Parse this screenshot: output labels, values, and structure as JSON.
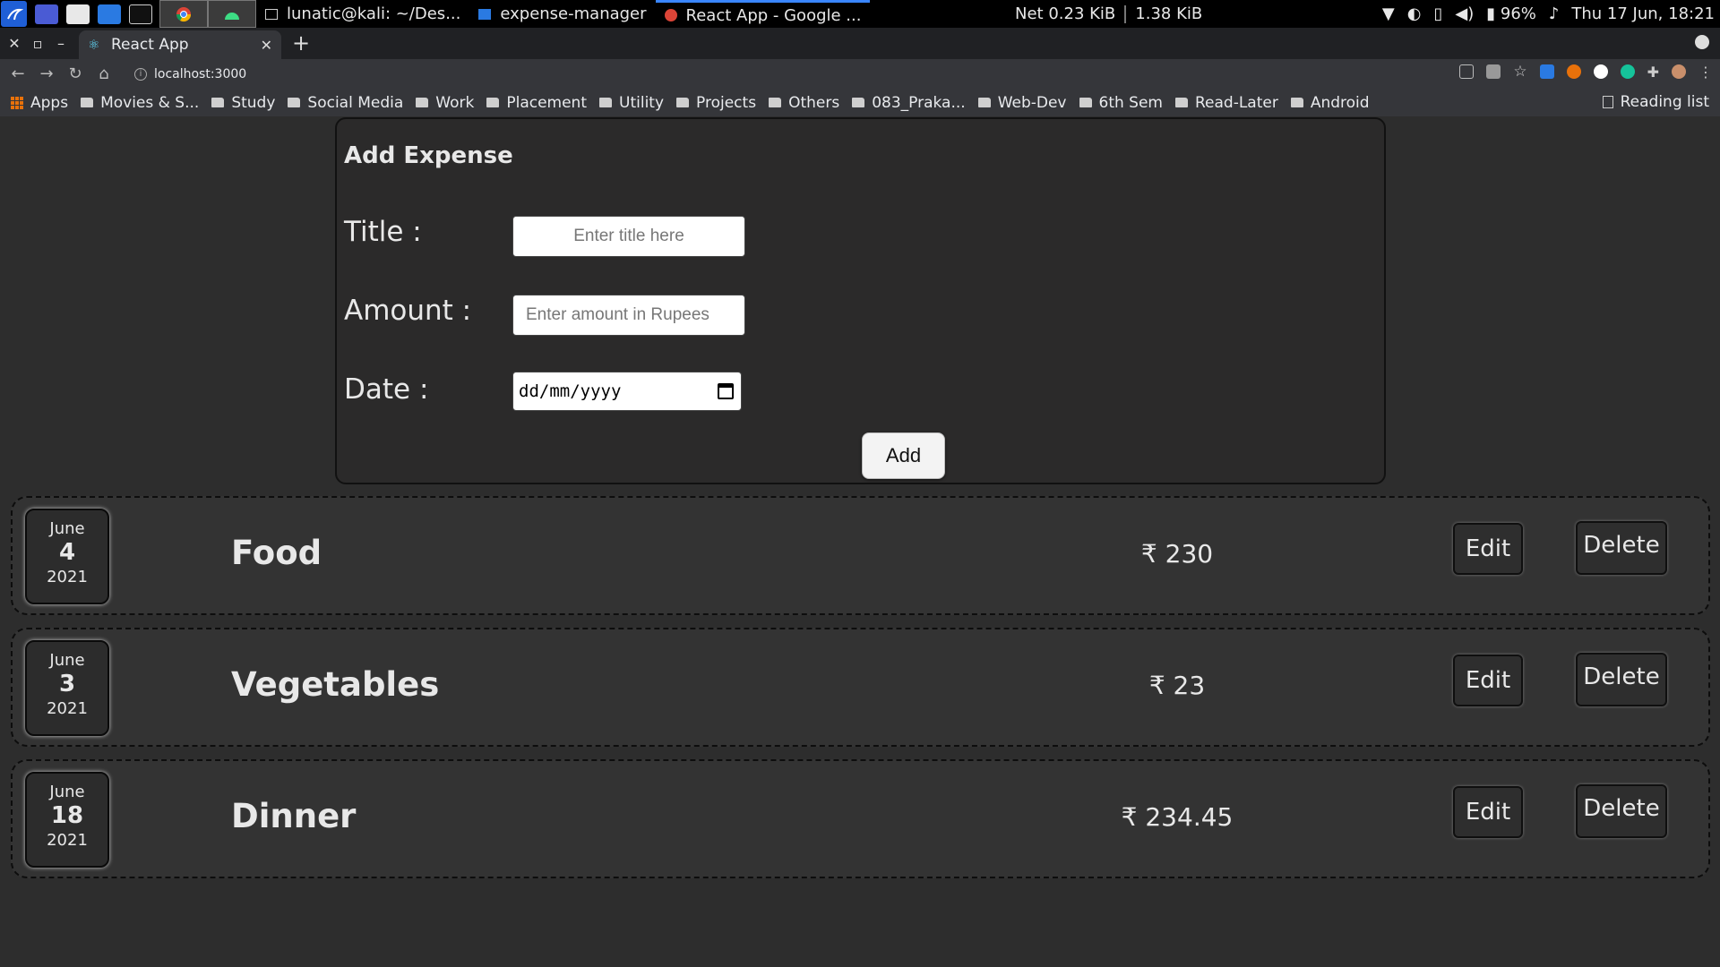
{
  "taskbar": {
    "tasks": [
      {
        "label": "lunatic@kali: ~/Des..."
      },
      {
        "label": "expense-manager"
      },
      {
        "label": "React App - Google ..."
      }
    ],
    "net_label": "Net 0.23 KiB",
    "net_up": "1.38 KiB",
    "battery": "96%",
    "clock": "Thu 17 Jun, 18:21"
  },
  "browser": {
    "tab_title": "React App",
    "url": "localhost:3000",
    "bookmarks": [
      "Apps",
      "Movies & S...",
      "Study",
      "Social Media",
      "Work",
      "Placement",
      "Utility",
      "Projects",
      "Others",
      "083_Praka...",
      "Web-Dev",
      "6th Sem",
      "Read-Later",
      "Android"
    ],
    "reading_list": "Reading list"
  },
  "form": {
    "heading": "Add Expense",
    "title_label": "Title :",
    "title_placeholder": "Enter title here",
    "amount_label": "Amount :",
    "amount_placeholder": "Enter amount in Rupees",
    "date_label": "Date :",
    "date_placeholder": "dd/mm/yyyy",
    "add_label": "Add"
  },
  "expenses": [
    {
      "month": "June",
      "day": "4",
      "year": "2021",
      "title": "Food",
      "amount": "₹ 230",
      "edit_label": "Edit",
      "delete_label": "Delete"
    },
    {
      "month": "June",
      "day": "3",
      "year": "2021",
      "title": "Vegetables",
      "amount": "₹ 23",
      "edit_label": "Edit",
      "delete_label": "Delete"
    },
    {
      "month": "June",
      "day": "18",
      "year": "2021",
      "title": "Dinner",
      "amount": "₹ 234.45",
      "edit_label": "Edit",
      "delete_label": "Delete"
    }
  ],
  "colors": {
    "page_bg": "#2d2d2d",
    "card_border": "#111111",
    "text": "#e8e8e8",
    "accent_blue": "#3a86ff"
  }
}
